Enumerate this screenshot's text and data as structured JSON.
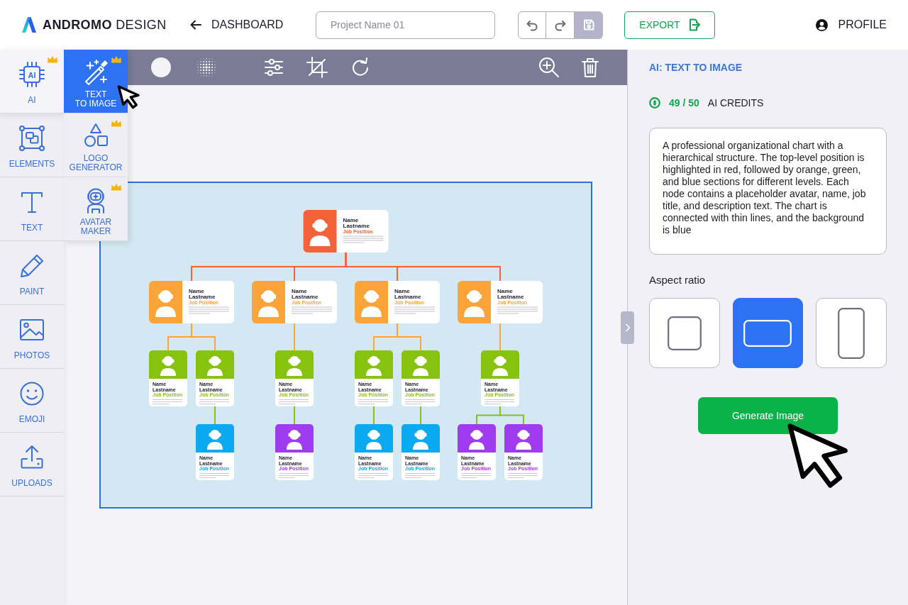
{
  "header": {
    "logo": {
      "text": "**ANDROMO** DESIGN"
    },
    "back_link": {
      "label": "DASHBOARD"
    },
    "project_name": {
      "placeholder": "Project Name 01"
    },
    "history_buttons": [
      {
        "kind": "undo",
        "disabled": false
      },
      {
        "kind": "redo",
        "disabled": false
      },
      {
        "kind": "save",
        "disabled": true
      }
    ],
    "export_button": {
      "label": "EXPORT"
    },
    "profile": {
      "label": "PROFILE"
    }
  },
  "sidebar": {
    "items": [
      {
        "kind": "ai",
        "label": "AI",
        "icon_text": "AI",
        "premium": true,
        "selected": true
      },
      {
        "kind": "elements",
        "label": "ELEMENTS",
        "premium": false,
        "selected": false
      },
      {
        "kind": "text",
        "label": "TEXT",
        "premium": false,
        "selected": false
      },
      {
        "kind": "paint",
        "label": "PAINT",
        "premium": false,
        "selected": false
      },
      {
        "kind": "photos",
        "label": "PHOTOS",
        "premium": false,
        "selected": false
      },
      {
        "kind": "emoji",
        "label": "EMOJI",
        "premium": false,
        "selected": false
      },
      {
        "kind": "uploads",
        "label": "UPLOADS",
        "premium": false,
        "selected": false
      }
    ]
  },
  "submenu": {
    "items": [
      {
        "kind": "wand",
        "label": "TEXT\nTO IMAGE",
        "premium": true,
        "selected": true
      },
      {
        "kind": "shapes",
        "label": "LOGO\nGENERATOR",
        "premium": true,
        "selected": false
      },
      {
        "kind": "astronaut",
        "label": "AVATAR\nMAKER",
        "premium": true,
        "selected": false
      }
    ]
  },
  "toolbar": {
    "tools": [
      {
        "kind": "fill"
      },
      {
        "kind": "halftone"
      },
      {
        "kind": "adjust"
      },
      {
        "kind": "crop"
      },
      {
        "kind": "rotate"
      }
    ],
    "actions": [
      {
        "kind": "zoom"
      },
      {
        "kind": "delete"
      }
    ]
  },
  "canvas": {
    "org_chart": {
      "kind": "wide",
      "name": "Name",
      "lastname": "Lastname",
      "position": "Job Position",
      "color": "#f4623a",
      "children": [
        {
          "kind": "wide",
          "name": "Name",
          "lastname": "Lastname",
          "position": "Job Position",
          "color": "#fba43a",
          "children": [
            {
              "kind": "tall",
              "name": "Name",
              "lastname": "Lastname",
              "position": "Job Position",
              "color": "#86c20e"
            },
            {
              "kind": "tall",
              "name": "Name",
              "lastname": "Lastname",
              "position": "Job Position",
              "color": "#86c20e",
              "children": [
                {
                  "kind": "tall",
                  "name": "Name",
                  "lastname": "Lastname",
                  "position": "Job Position",
                  "color": "#0ba9ef"
                }
              ]
            }
          ]
        },
        {
          "kind": "wide",
          "name": "Name",
          "lastname": "Lastname",
          "position": "Job Position",
          "color": "#fba43a",
          "children": [
            {
              "kind": "tall",
              "name": "Name",
              "lastname": "Lastname",
              "position": "Job Position",
              "color": "#86c20e",
              "children": [
                {
                  "kind": "tall",
                  "name": "Name",
                  "lastname": "Lastname",
                  "position": "Job Position",
                  "color": "#a03cf0"
                }
              ]
            }
          ]
        },
        {
          "kind": "wide",
          "name": "Name",
          "lastname": "Lastname",
          "position": "Job Position",
          "color": "#fba43a",
          "children": [
            {
              "kind": "tall",
              "name": "Name",
              "lastname": "Lastname",
              "position": "Job Position",
              "color": "#86c20e",
              "children": [
                {
                  "kind": "tall",
                  "name": "Name",
                  "lastname": "Lastname",
                  "position": "Job Position",
                  "color": "#0ba9ef"
                }
              ]
            },
            {
              "kind": "tall",
              "name": "Name",
              "lastname": "Lastname",
              "position": "Job Position",
              "color": "#86c20e",
              "children": [
                {
                  "kind": "tall",
                  "name": "Name",
                  "lastname": "Lastname",
                  "position": "Job Position",
                  "color": "#0ba9ef"
                }
              ]
            }
          ]
        },
        {
          "kind": "wide",
          "name": "Name",
          "lastname": "Lastname",
          "position": "Job Position",
          "color": "#fba43a",
          "children": [
            {
              "kind": "tall",
              "name": "Name",
              "lastname": "Lastname",
              "position": "Job Position",
              "color": "#86c20e",
              "children": [
                {
                  "kind": "tall",
                  "name": "Name",
                  "lastname": "Lastname",
                  "position": "Job Position",
                  "color": "#a03cf0"
                },
                {
                  "kind": "tall",
                  "name": "Name",
                  "lastname": "Lastname",
                  "position": "Job Position",
                  "color": "#a03cf0"
                }
              ]
            }
          ]
        }
      ]
    }
  },
  "panel": {
    "title": "AI: TEXT TO IMAGE",
    "credits": {
      "count": "49 / 50",
      "label": "AI CREDITS"
    },
    "prompt": {
      "value": "A professional organizational chart with a hierarchical structure. The top-level position is highlighted in red, followed by orange, green, and blue sections for different levels. Each node contains a placeholder avatar, name, job title, and description text. The chart is connected with thin lines, and the background is blue"
    },
    "aspect_ratio": {
      "label": "Aspect ratio",
      "options": [
        {
          "kind": "square",
          "selected": false
        },
        {
          "kind": "landscape",
          "selected": true
        },
        {
          "kind": "portrait",
          "selected": false
        }
      ]
    },
    "generate_button": {
      "label": "Generate Image"
    }
  }
}
